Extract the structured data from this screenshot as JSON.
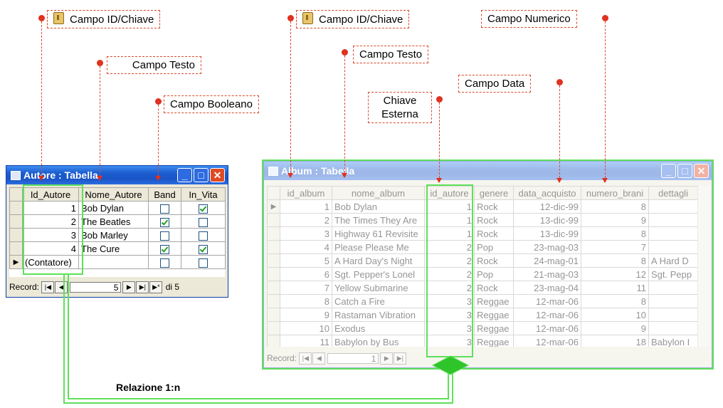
{
  "callouts": {
    "left_id": "Campo ID/Chiave",
    "left_text": "Campo Testo",
    "left_bool": "Campo Booleano",
    "right_id": "Campo ID/Chiave",
    "right_numeric": "Campo Numerico",
    "right_text": "Campo Testo",
    "right_date": "Campo Data",
    "right_fk_line1": "Chiave",
    "right_fk_line2": "Esterna"
  },
  "relation_label": "Relazione 1:n",
  "autore": {
    "title": "Autore : Tabella",
    "columns": [
      "Id_Autore",
      "Nome_Autore",
      "Band",
      "In_Vita"
    ],
    "rows": [
      {
        "id": "1",
        "name": "Bob Dylan",
        "band": false,
        "alive": true
      },
      {
        "id": "2",
        "name": "The Beatles",
        "band": true,
        "alive": false
      },
      {
        "id": "3",
        "name": "Bob Marley",
        "band": false,
        "alive": false
      },
      {
        "id": "4",
        "name": "The Cure",
        "band": true,
        "alive": true
      }
    ],
    "new_row_placeholder": "(Contatore)",
    "record_label": "Record:",
    "record_current": "5",
    "record_total": "di 5"
  },
  "album": {
    "title": "Album : Tabella",
    "columns": [
      "id_album",
      "nome_album",
      "id_autore",
      "genere",
      "data_acquisto",
      "numero_brani",
      "dettagli"
    ],
    "rows": [
      [
        "1",
        "Bob Dylan",
        "1",
        "Rock",
        "12-dic-99",
        "8",
        ""
      ],
      [
        "2",
        "The Times They Are",
        "1",
        "Rock",
        "13-dic-99",
        "9",
        ""
      ],
      [
        "3",
        "Highway 61 Revisite",
        "1",
        "Rock",
        "13-dic-99",
        "8",
        ""
      ],
      [
        "4",
        "Please Please Me",
        "2",
        "Pop",
        "23-mag-03",
        "7",
        ""
      ],
      [
        "5",
        "A Hard Day's Night",
        "2",
        "Rock",
        "24-mag-01",
        "8",
        "A Hard D"
      ],
      [
        "6",
        "Sgt. Pepper's Lonel",
        "2",
        "Pop",
        "21-mag-03",
        "12",
        "Sgt. Pepp"
      ],
      [
        "7",
        "Yellow Submarine",
        "2",
        "Rock",
        "23-mag-04",
        "11",
        ""
      ],
      [
        "8",
        "Catch a Fire",
        "3",
        "Reggae",
        "12-mar-06",
        "8",
        ""
      ],
      [
        "9",
        "Rastaman Vibration",
        "3",
        "Reggae",
        "12-mar-06",
        "10",
        ""
      ],
      [
        "10",
        "Exodus",
        "3",
        "Reggae",
        "12-mar-06",
        "9",
        ""
      ],
      [
        "11",
        "Babylon by Bus",
        "3",
        "Reggae",
        "12-mar-06",
        "18",
        "Babylon I"
      ]
    ],
    "record_label": "Record:",
    "record_current": "1"
  },
  "colors": {
    "highlight_green": "#5fe05a",
    "callout_red": "#e0301e",
    "xp_title_blue": "#1b5ccf"
  }
}
